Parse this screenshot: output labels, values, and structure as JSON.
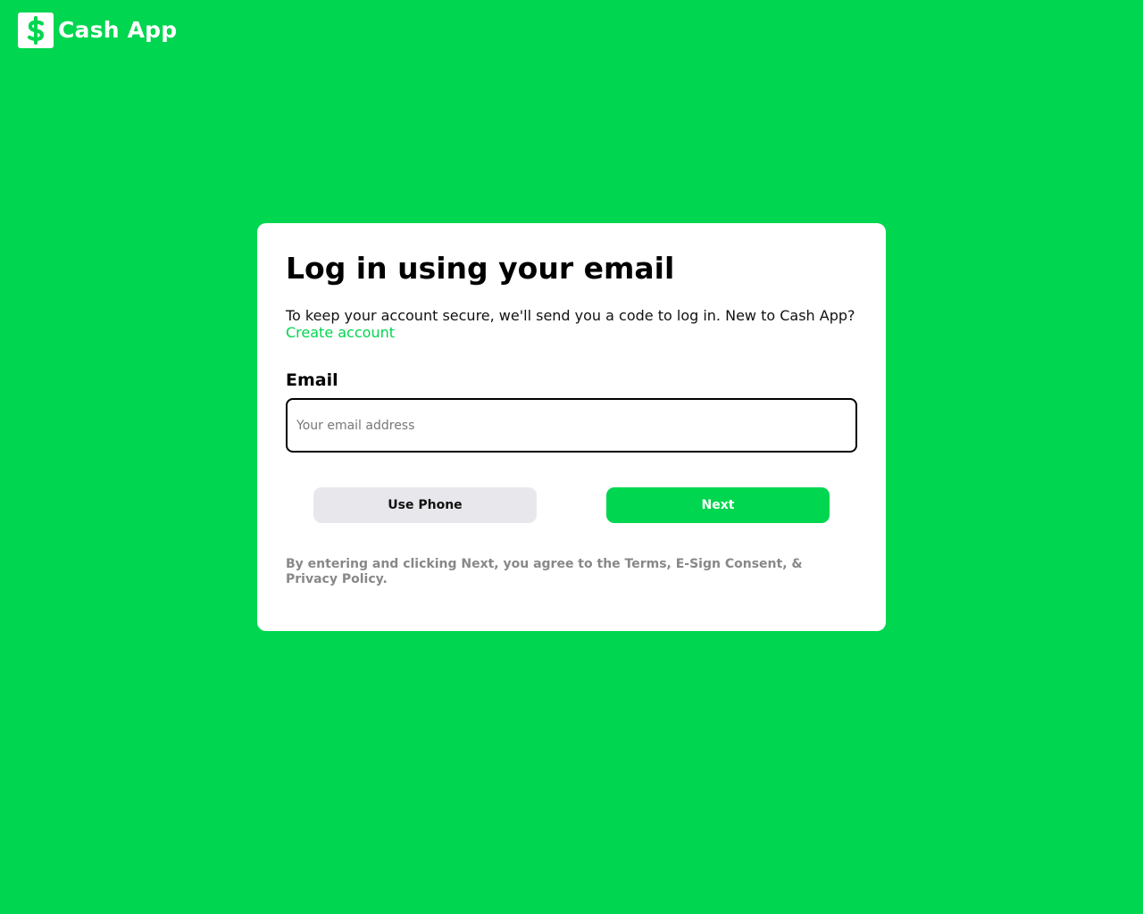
{
  "brand": {
    "name": "Cash App",
    "logo_icon": "dollar-sign-icon",
    "logo_color": "#00d64f"
  },
  "colors": {
    "background": "#00d64f",
    "accent": "#00d64f",
    "card": "#ffffff",
    "secondary_button": "#e8e8ec",
    "legal_text": "#888888"
  },
  "login": {
    "title": "Log in using your email",
    "subtitle": "To keep your account secure, we'll send you a code to log in. New to Cash App?",
    "create_account_link": "Create account",
    "email_label": "Email",
    "email_placeholder": "Your email address",
    "email_value": "",
    "use_phone_button": "Use Phone",
    "next_button": "Next",
    "legal_text": "By entering and clicking Next, you agree to the Terms, E-Sign Consent, & Privacy Policy."
  }
}
